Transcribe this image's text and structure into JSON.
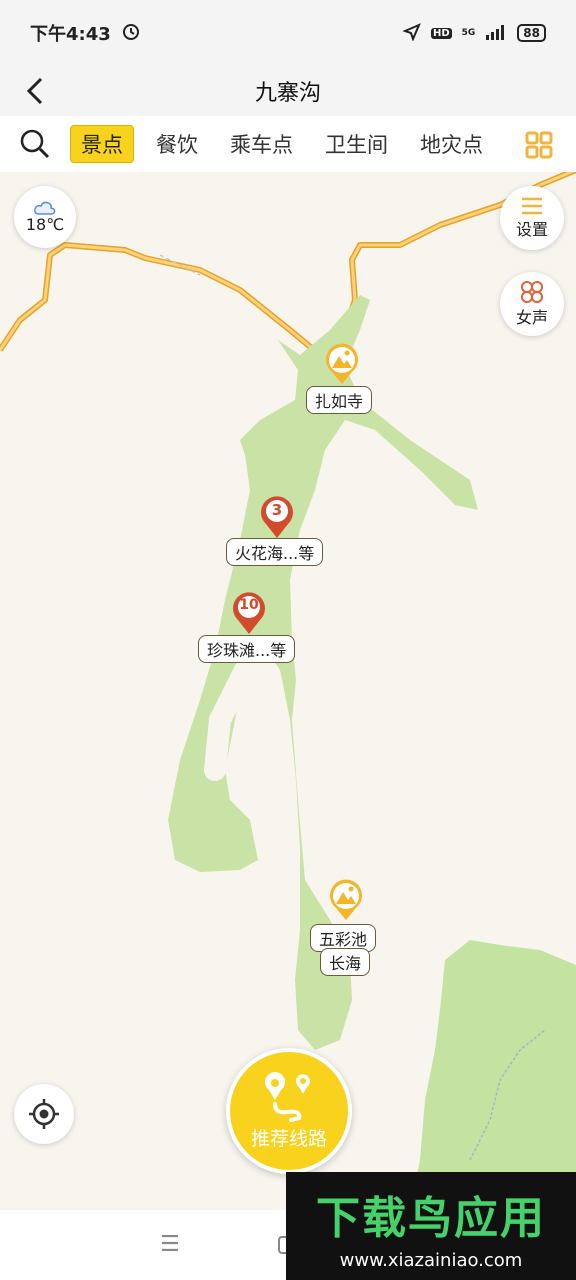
{
  "status": {
    "time": "下午4:43",
    "network": "5G",
    "hd": "HD",
    "battery": "88"
  },
  "header": {
    "title": "九寨沟"
  },
  "tabs": [
    "景点",
    "餐饮",
    "乘车点",
    "卫生间",
    "地灾点"
  ],
  "active_tab": "景点",
  "weather": {
    "temp": "18℃"
  },
  "side_buttons": {
    "settings": "设置",
    "voice": "女声"
  },
  "pins": {
    "zharu": "扎如寺",
    "huohua_count": "3",
    "huohua": "火花海...等",
    "zhenzhu_count": "10",
    "zhenzhu": "珍珠滩...等",
    "wucai": "五彩池",
    "changhai": "长海"
  },
  "route_button": "推荐线路",
  "watermark": {
    "title": "下载鸟应用",
    "url": "www.xiazainiao.com"
  },
  "colors": {
    "accent": "#f8d21d",
    "green_area": "#c9e3a6",
    "road": "#f2b53c",
    "red_pin": "#d14b2c"
  }
}
